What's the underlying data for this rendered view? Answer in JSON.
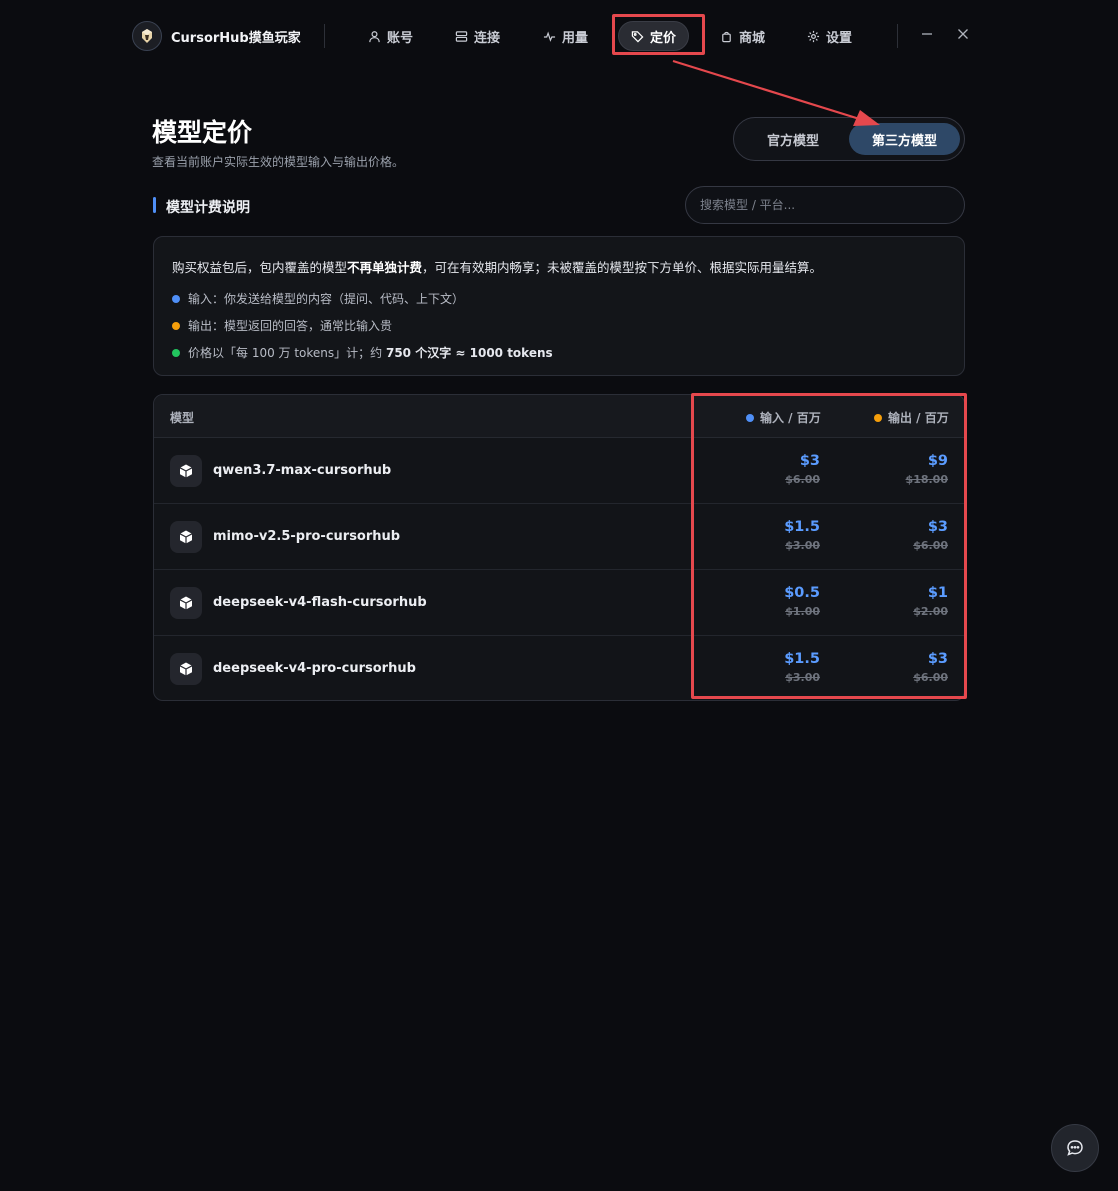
{
  "app": {
    "brand": "CursorHub摸鱼玩家"
  },
  "nav": [
    {
      "label": "账号",
      "icon": "user-icon"
    },
    {
      "label": "连接",
      "icon": "server-icon"
    },
    {
      "label": "用量",
      "icon": "activity-icon"
    },
    {
      "label": "定价",
      "icon": "tag-icon",
      "active": true
    },
    {
      "label": "商城",
      "icon": "shopping-bag-icon"
    },
    {
      "label": "设置",
      "icon": "gear-icon"
    }
  ],
  "header": {
    "title": "模型定价",
    "subtitle": "查看当前账户实际生效的模型输入与输出价格。",
    "toggle": {
      "official": "官方模型",
      "third_party": "第三方模型",
      "selected": "third_party"
    }
  },
  "section": {
    "title": "模型计费说明"
  },
  "search": {
    "placeholder": "搜索模型 / 平台...",
    "value": ""
  },
  "info": {
    "line_pre": "购买权益包后，包内覆盖的模型",
    "line_bold": "不再单独计费",
    "line_post": "，可在有效期内畅享；未被覆盖的模型按下方单价、根据实际用量结算。",
    "input": "输入：你发送给模型的内容（提问、代码、上下文）",
    "output": "输出：模型返回的回答，通常比输入贵",
    "price_pre": "价格以「每 100 万 tokens」计；约 ",
    "price_bold": "750 个汉字 ≈ 1000 tokens",
    "colors": {
      "input": "#4f8ff7",
      "output": "#f59e0b",
      "price": "#22c55e"
    }
  },
  "table": {
    "headers": {
      "model": "模型",
      "input": "输入 / 百万",
      "output": "输出 / 百万"
    },
    "rows": [
      {
        "name": "qwen3.7-max-cursorhub",
        "input": "$3",
        "input_old": "$6.00",
        "output": "$9",
        "output_old": "$18.00"
      },
      {
        "name": "mimo-v2.5-pro-cursorhub",
        "input": "$1.5",
        "input_old": "$3.00",
        "output": "$3",
        "output_old": "$6.00"
      },
      {
        "name": "deepseek-v4-flash-cursorhub",
        "input": "$0.5",
        "input_old": "$1.00",
        "output": "$1",
        "output_old": "$2.00"
      },
      {
        "name": "deepseek-v4-pro-cursorhub",
        "input": "$1.5",
        "input_old": "$3.00",
        "output": "$3",
        "output_old": "$6.00"
      }
    ]
  },
  "colors": {
    "accent": "#5b9cff",
    "highlight": "#e5484d",
    "toggle_active": "#2e4867"
  }
}
